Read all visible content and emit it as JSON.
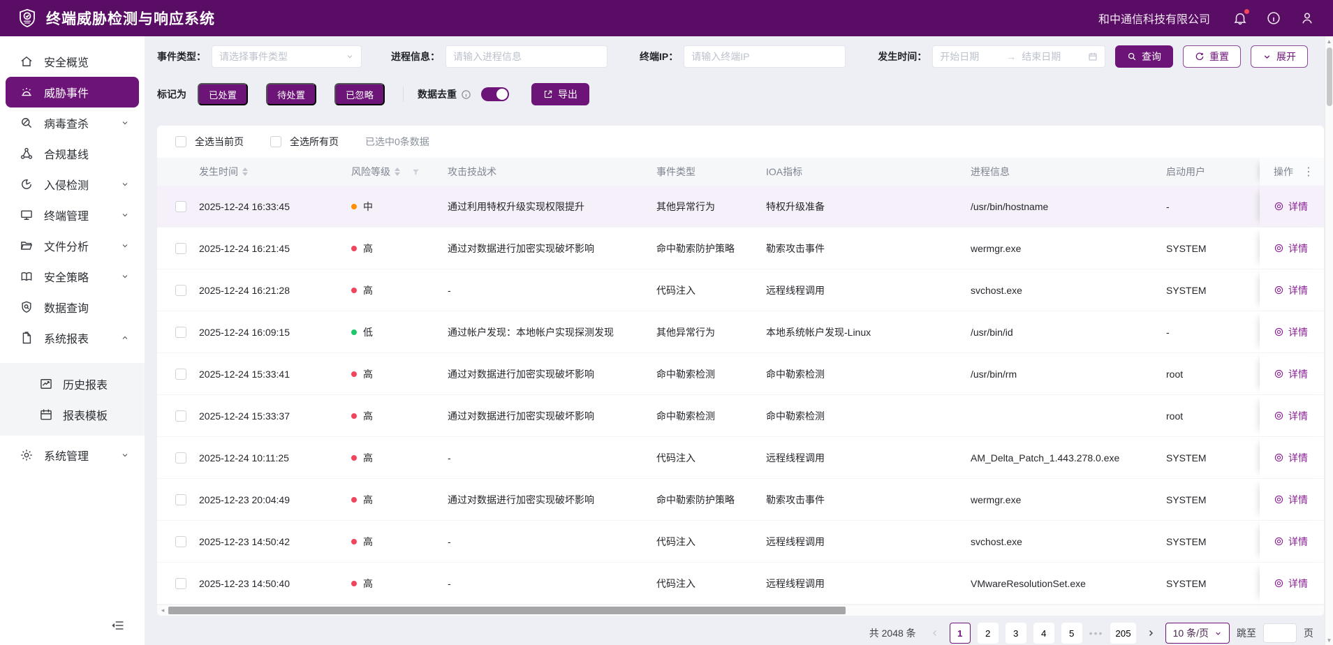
{
  "brand": {
    "title": "终端威胁检测与响应系统",
    "company": "和中通信科技有限公司",
    "logo_icon": "shield-check"
  },
  "topbar_icons": [
    "bell-icon",
    "info-circle-icon",
    "user-icon"
  ],
  "colors": {
    "primary": "#5a0d64",
    "accent": "#6d1478",
    "link": "#8a1f96",
    "row_highlight": "#f5f0f9"
  },
  "risk_colors": {
    "高": "#f2455d",
    "中": "#ff8f00",
    "低": "#1ec76a"
  },
  "sidebar": {
    "items": [
      {
        "label": "安全概览",
        "icon": "home"
      },
      {
        "label": "威胁事件",
        "icon": "alarm",
        "active": true
      },
      {
        "label": "病毒查杀",
        "icon": "virus-scan",
        "chevron": "down"
      },
      {
        "label": "合规基线",
        "icon": "baseline-nodes"
      },
      {
        "label": "入侵检测",
        "icon": "intrusion-pie",
        "chevron": "down"
      },
      {
        "label": "终端管理",
        "icon": "monitor",
        "chevron": "down"
      },
      {
        "label": "文件分析",
        "icon": "folder-open",
        "chevron": "down"
      },
      {
        "label": "安全策略",
        "icon": "book-open",
        "chevron": "down"
      },
      {
        "label": "数据查询",
        "icon": "shield-search"
      },
      {
        "label": "系统报表",
        "icon": "report-doc",
        "chevron": "up"
      }
    ],
    "report_children": [
      {
        "label": "历史报表",
        "icon": "trend-chart"
      },
      {
        "label": "报表模板",
        "icon": "calendar"
      }
    ],
    "tail_items": [
      {
        "label": "系统管理",
        "icon": "gear",
        "chevron": "down"
      }
    ]
  },
  "filters": {
    "event_type_label": "事件类型：",
    "event_type_placeholder": "请选择事件类型",
    "process_label": "进程信息：",
    "process_placeholder": "请输入进程信息",
    "ip_label": "终端IP：",
    "ip_placeholder": "请输入终端IP",
    "time_label": "发生时间：",
    "date_start_placeholder": "开始日期",
    "date_end_placeholder": "结束日期",
    "search_button": "查询",
    "reset_button": "重置",
    "expand_button": "展开"
  },
  "actions": {
    "mark_label": "标记为",
    "mark_buttons": {
      "handled": "已处置",
      "pending": "待处置",
      "ignored": "已忽略"
    },
    "dedupe_label": "数据去重",
    "dedupe_on": true,
    "export_button": "导出"
  },
  "selection": {
    "select_page": "全选当前页",
    "select_all": "全选所有页",
    "selected_info": "已选中0条数据"
  },
  "table": {
    "columns": {
      "time": "发生时间",
      "risk": "风险等级",
      "tactic": "攻击技战术",
      "event_type": "事件类型",
      "ioa": "IOA指标",
      "process": "进程信息",
      "user": "启动用户",
      "action": "操作"
    },
    "action_label": "详情",
    "rows": [
      {
        "time": "2025-12-24 16:33:45",
        "risk": "中",
        "tactic": "通过利用特权升级实现权限提升",
        "event_type": "其他异常行为",
        "ioa": "特权升级准备",
        "process": "/usr/bin/hostname",
        "user": "-",
        "highlight": true
      },
      {
        "time": "2025-12-24 16:21:45",
        "risk": "高",
        "tactic": "通过对数据进行加密实现破坏影响",
        "event_type": "命中勒索防护策略",
        "ioa": "勒索攻击事件",
        "process": "wermgr.exe",
        "user": "SYSTEM"
      },
      {
        "time": "2025-12-24 16:21:28",
        "risk": "高",
        "tactic": "-",
        "event_type": "代码注入",
        "ioa": "远程线程调用",
        "process": "svchost.exe",
        "user": "SYSTEM"
      },
      {
        "time": "2025-12-24 16:09:15",
        "risk": "低",
        "tactic": "通过帐户发现：本地帐户实现探测发现",
        "event_type": "其他异常行为",
        "ioa": "本地系统帐户发现-Linux",
        "process": "/usr/bin/id",
        "user": "-"
      },
      {
        "time": "2025-12-24 15:33:41",
        "risk": "高",
        "tactic": "通过对数据进行加密实现破坏影响",
        "event_type": "命中勒索检测",
        "ioa": "命中勒索检测",
        "process": "/usr/bin/rm",
        "user": "root"
      },
      {
        "time": "2025-12-24 15:33:37",
        "risk": "高",
        "tactic": "通过对数据进行加密实现破坏影响",
        "event_type": "命中勒索检测",
        "ioa": "命中勒索检测",
        "process": "",
        "user": "root"
      },
      {
        "time": "2025-12-24 10:11:25",
        "risk": "高",
        "tactic": "-",
        "event_type": "代码注入",
        "ioa": "远程线程调用",
        "process": "AM_Delta_Patch_1.443.278.0.exe",
        "user": "SYSTEM"
      },
      {
        "time": "2025-12-23 20:04:49",
        "risk": "高",
        "tactic": "通过对数据进行加密实现破坏影响",
        "event_type": "命中勒索防护策略",
        "ioa": "勒索攻击事件",
        "process": "wermgr.exe",
        "user": "SYSTEM"
      },
      {
        "time": "2025-12-23 14:50:42",
        "risk": "高",
        "tactic": "-",
        "event_type": "代码注入",
        "ioa": "远程线程调用",
        "process": "svchost.exe",
        "user": "SYSTEM"
      },
      {
        "time": "2025-12-23 14:50:40",
        "risk": "高",
        "tactic": "-",
        "event_type": "代码注入",
        "ioa": "远程线程调用",
        "process": "VMwareResolutionSet.exe",
        "user": "SYSTEM"
      }
    ]
  },
  "pagination": {
    "total": "共 2048 条",
    "pages": [
      "1",
      "2",
      "3",
      "4",
      "5"
    ],
    "current": "1",
    "ellipsis": "•••",
    "last_page": "205",
    "page_size": "10 条/页",
    "jump_label": "跳至",
    "page_unit": "页"
  }
}
